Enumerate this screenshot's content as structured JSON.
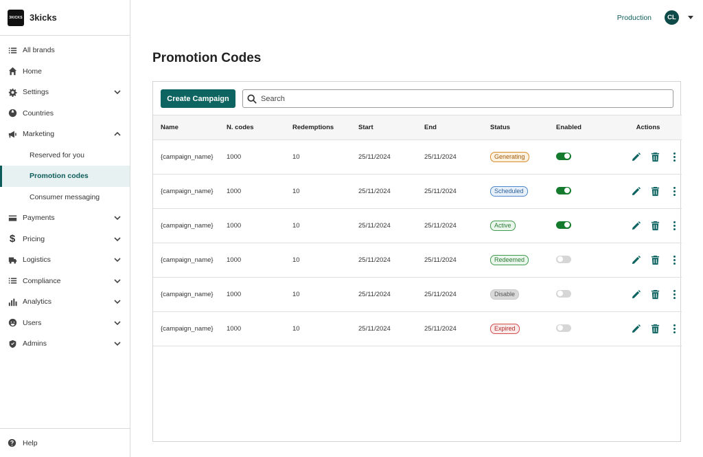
{
  "brand": {
    "logo_text": "3KICKS",
    "name": "3kicks"
  },
  "sidebar": {
    "items": [
      {
        "label": "All brands"
      },
      {
        "label": "Home"
      },
      {
        "label": "Settings"
      },
      {
        "label": "Countries"
      },
      {
        "label": "Marketing"
      },
      {
        "label": "Reserved for you"
      },
      {
        "label": "Promotion codes"
      },
      {
        "label": "Consumer messaging"
      },
      {
        "label": "Payments"
      },
      {
        "label": "Pricing"
      },
      {
        "label": "Logistics"
      },
      {
        "label": "Compliance"
      },
      {
        "label": "Analytics"
      },
      {
        "label": "Users"
      },
      {
        "label": "Admins"
      }
    ],
    "help": "Help"
  },
  "header": {
    "environment": "Production",
    "avatar_initials": "CL"
  },
  "page": {
    "title": "Promotion Codes"
  },
  "toolbar": {
    "create_label": "Create Campaign",
    "search_placeholder": "Search"
  },
  "table": {
    "columns": [
      "Name",
      "N. codes",
      "Redemptions",
      "Start",
      "End",
      "Status",
      "Enabled",
      "Actions"
    ],
    "rows": [
      {
        "name": "{campaign_name}",
        "codes": "1000",
        "redemptions": "10",
        "start": "25/11/2024",
        "end": "25/11/2024",
        "status": "Generating",
        "enabled": true
      },
      {
        "name": "{campaign_name}",
        "codes": "1000",
        "redemptions": "10",
        "start": "25/11/2024",
        "end": "25/11/2024",
        "status": "Scheduled",
        "enabled": true
      },
      {
        "name": "{campaign_name}",
        "codes": "1000",
        "redemptions": "10",
        "start": "25/11/2024",
        "end": "25/11/2024",
        "status": "Active",
        "enabled": true
      },
      {
        "name": "{campaign_name}",
        "codes": "1000",
        "redemptions": "10",
        "start": "25/11/2024",
        "end": "25/11/2024",
        "status": "Redeemed",
        "enabled": false
      },
      {
        "name": "{campaign_name}",
        "codes": "1000",
        "redemptions": "10",
        "start": "25/11/2024",
        "end": "25/11/2024",
        "status": "Disable",
        "enabled": false
      },
      {
        "name": "{campaign_name}",
        "codes": "1000",
        "redemptions": "10",
        "start": "25/11/2024",
        "end": "25/11/2024",
        "status": "Expired",
        "enabled": false
      }
    ]
  },
  "status_colors": {
    "Generating": {
      "border": "#d98b2b",
      "bg": "#fdf1e0",
      "text": "#a35c0c"
    },
    "Scheduled": {
      "border": "#4a86c8",
      "bg": "#e8f1fb",
      "text": "#2a5f9a"
    },
    "Active": {
      "border": "#3e9a4c",
      "bg": "#ebf7ec",
      "text": "#2a7a35"
    },
    "Redeemed": {
      "border": "#3e9a4c",
      "bg": "#ebf7ec",
      "text": "#2a7a35"
    },
    "Disable": {
      "border": "#c8c8c8",
      "bg": "#d9d9d9",
      "text": "#555555"
    },
    "Expired": {
      "border": "#d34a4a",
      "bg": "#fbeaea",
      "text": "#b32a2a"
    }
  },
  "colors": {
    "accent": "#0d6461",
    "active_nav_bg": "#e8f1f1"
  }
}
